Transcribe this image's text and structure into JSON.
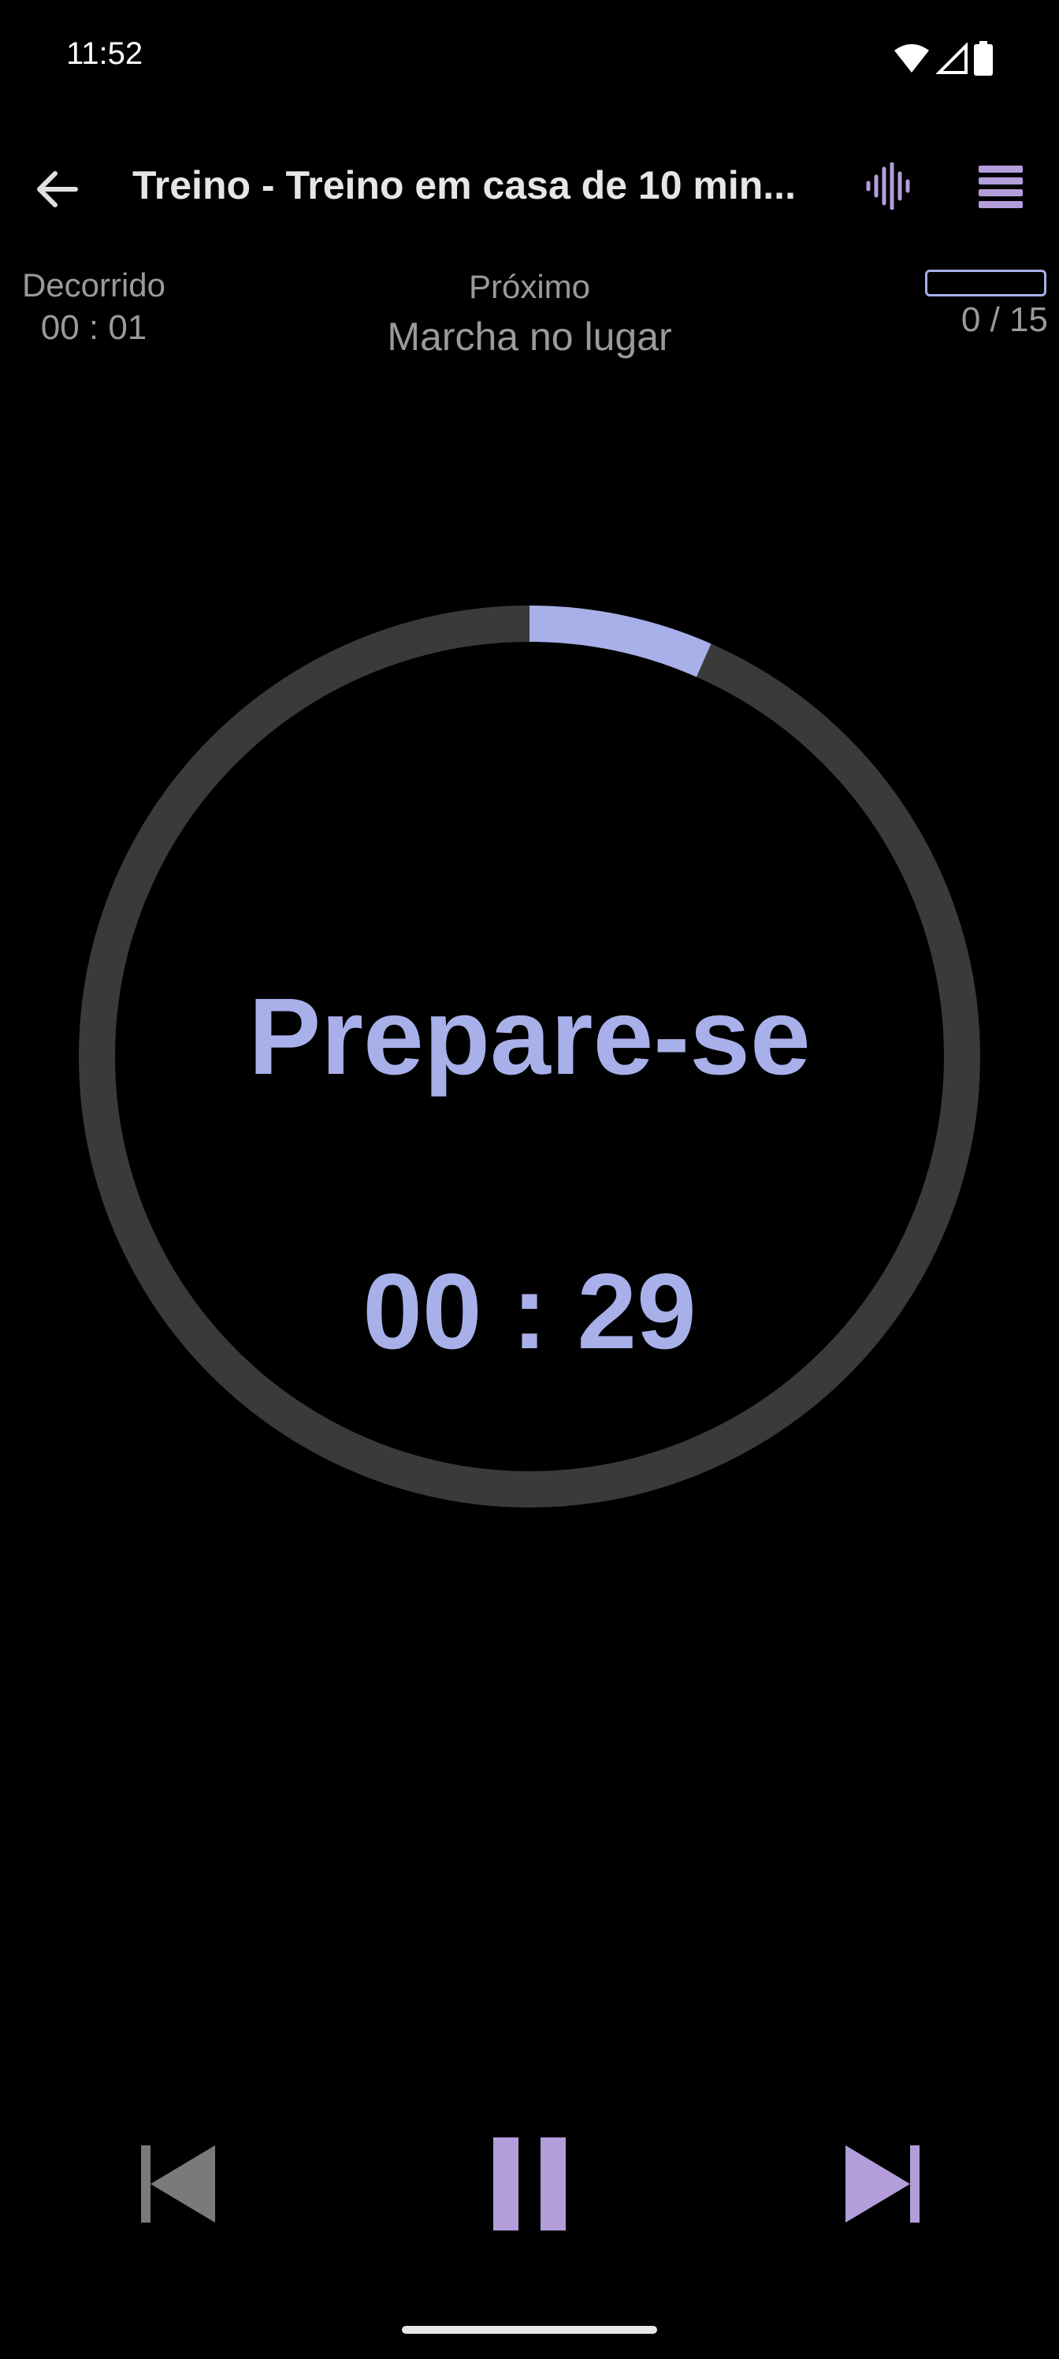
{
  "status_bar": {
    "time": "11:52",
    "icons": [
      "wifi-icon",
      "signal-icon",
      "battery-icon"
    ]
  },
  "app_bar": {
    "title": "Treino - Treino em casa de 10 min...",
    "icons": [
      "back-arrow-icon",
      "audio-wave-icon",
      "menu-icon"
    ]
  },
  "info": {
    "elapsed_label": "Decorrido",
    "elapsed_value": "00 : 01",
    "next_label": "Próximo",
    "next_value": "Marcha no lugar",
    "progress_count": "0 / 15",
    "progress_fraction": 0
  },
  "timer": {
    "phase": "Prepare-se",
    "countdown": "00 : 29",
    "ring_progress": 0.066
  },
  "controls": {
    "icons": [
      "skip-previous-icon",
      "pause-icon",
      "skip-next-icon"
    ]
  },
  "colors": {
    "accent": "#a8b0ea",
    "accent_purple": "#b39ddb",
    "ring_track": "#3a3a3a",
    "background": "#000000",
    "control_disabled": "#7a7a7a"
  }
}
